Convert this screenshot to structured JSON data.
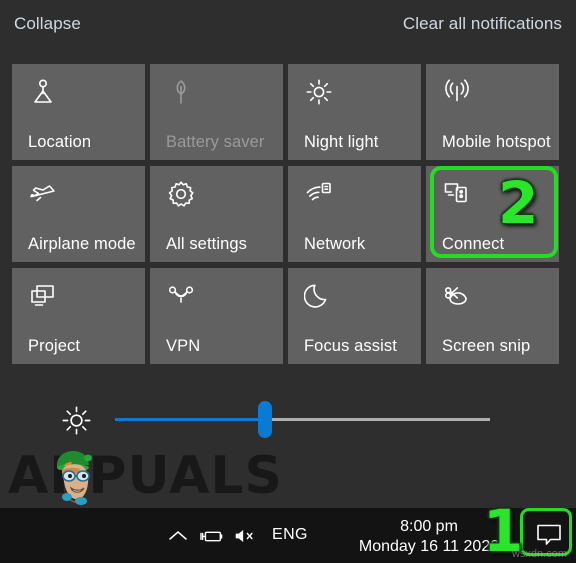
{
  "window": {
    "name": "Windows 10 Action Center",
    "panel_bg": "#2e2e2e",
    "tile_bg": "#616161",
    "accent": "#0a7bd4",
    "annotation_color": "#22dd22"
  },
  "header": {
    "collapse_label": "Collapse",
    "clear_label": "Clear all notifications"
  },
  "tiles": [
    {
      "label": "Location",
      "icon": "location-icon",
      "enabled": true,
      "highlighted": false
    },
    {
      "label": "Battery saver",
      "icon": "leaf-icon",
      "enabled": false,
      "highlighted": false
    },
    {
      "label": "Night light",
      "icon": "brightness-sun-icon",
      "enabled": true,
      "highlighted": false
    },
    {
      "label": "Mobile hotspot",
      "icon": "hotspot-icon",
      "enabled": true,
      "highlighted": false
    },
    {
      "label": "Airplane mode",
      "icon": "airplane-icon",
      "enabled": true,
      "highlighted": false
    },
    {
      "label": "All settings",
      "icon": "gear-icon",
      "enabled": true,
      "highlighted": false
    },
    {
      "label": "Network",
      "icon": "network-wifi-icon",
      "enabled": true,
      "highlighted": false
    },
    {
      "label": "Connect",
      "icon": "connect-cast-icon",
      "enabled": true,
      "highlighted": true
    },
    {
      "label": "Project",
      "icon": "project-display-icon",
      "enabled": true,
      "highlighted": false
    },
    {
      "label": "VPN",
      "icon": "vpn-icon",
      "enabled": true,
      "highlighted": false
    },
    {
      "label": "Focus assist",
      "icon": "moon-icon",
      "enabled": true,
      "highlighted": false
    },
    {
      "label": "Screen snip",
      "icon": "snip-scissors-icon",
      "enabled": true,
      "highlighted": false
    }
  ],
  "brightness": {
    "icon": "brightness-sun-icon",
    "value_percent": 40,
    "fill_color": "#0a7bd4",
    "track_color": "#b0b0b0"
  },
  "annotations": [
    {
      "id": "step-2",
      "label": "2",
      "target": "Connect tile"
    },
    {
      "id": "step-1",
      "label": "1",
      "target": "Action Center taskbar button"
    }
  ],
  "watermark": {
    "brand": "APPUALS",
    "brand_prefix": "A",
    "brand_suffix": "PUALS",
    "site": "wsxdn.com"
  },
  "taskbar": {
    "show_hidden_icons": "show-hidden-icons-chevron",
    "battery": "battery-charging-icon",
    "volume": "speaker-muted-icon",
    "language": "ENG",
    "time": "8:00 pm",
    "date": "Monday 16 11 2020",
    "notifications": "action-center-icon"
  }
}
